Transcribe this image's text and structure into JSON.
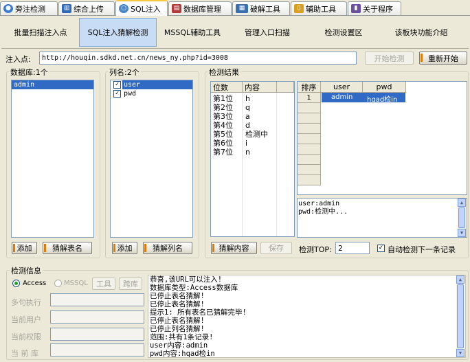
{
  "tabs": [
    {
      "label": "旁注检测",
      "icon": "globe-icon",
      "color": "#3A7BD5"
    },
    {
      "label": "综合上传",
      "icon": "chart-icon",
      "color": "#2F6AB8"
    },
    {
      "label": "SQL注入",
      "icon": "magnifier-icon",
      "color": "#4A86C8"
    },
    {
      "label": "数据库管理",
      "icon": "database-icon",
      "color": "#B33A3A"
    },
    {
      "label": "破解工具",
      "icon": "keyboard-icon",
      "color": "#3C6FB0"
    },
    {
      "label": "辅助工具",
      "icon": "notebook-icon",
      "color": "#D8A020"
    },
    {
      "label": "关于程序",
      "icon": "book-icon",
      "color": "#6B4FA0"
    }
  ],
  "subtabs": [
    "批量扫描注入点",
    "SQL注入猜解检测",
    "MSSQL辅助工具",
    "管理入口扫描",
    "检测设置区",
    "该板块功能介绍"
  ],
  "injection": {
    "label": "注入点:",
    "url": "http://houqin.sdkd.net.cn/news_ny.php?id=3008",
    "start_button": "开始检测",
    "restart_button": "重新开始"
  },
  "database": {
    "title": "数据库:1个",
    "items": [
      "admin"
    ],
    "add_button": "添加",
    "guess_button": "猜解表名"
  },
  "columns": {
    "title": "列名:2个",
    "items": [
      "user",
      "pwd"
    ],
    "add_button": "添加",
    "guess_button": "猜解列名"
  },
  "results": {
    "title": "检测结果",
    "pos_header": "位数",
    "content_header": "内容",
    "rows": [
      {
        "pos": "第1位",
        "val": "h"
      },
      {
        "pos": "第2位",
        "val": "q"
      },
      {
        "pos": "第3位",
        "val": "a"
      },
      {
        "pos": "第4位",
        "val": "d"
      },
      {
        "pos": "第5位",
        "val": "检测中"
      },
      {
        "pos": "第6位",
        "val": "i"
      },
      {
        "pos": "第7位",
        "val": "n"
      }
    ],
    "table_headers": [
      "排序",
      "user",
      "pwd"
    ],
    "table_rows": [
      {
        "n": "1",
        "user": "admin",
        "pwd": "hqad检in"
      }
    ],
    "summary": [
      "user:admin",
      "pwd:检测中..."
    ],
    "guess_button": "猜解内容",
    "save_button": "保存",
    "top_label": "检测TOP:",
    "top_value": "2",
    "auto_label": "自动检测下一条记录"
  },
  "info": {
    "title": "检测信息",
    "db_access": "Access",
    "db_mssql": "MSSQL",
    "tool_button": "工具",
    "crossdb_button": "跨库",
    "multi_label": "多句执行",
    "user_label": "当前用户",
    "perm_label": "当前权限",
    "curdb_label": "当 前 库",
    "log": [
      "恭喜,该URL可以注入!",
      "数据库类型:Access数据库",
      "已停止表名猜解!",
      "已停止表名猜解!",
      "提示1: 所有表名已猜解完毕!",
      "已停止表名猜解!",
      "已停止列名猜解!",
      "范围:共有1条记录!",
      "user内容:admin",
      "pwd内容:hqad检in"
    ]
  }
}
